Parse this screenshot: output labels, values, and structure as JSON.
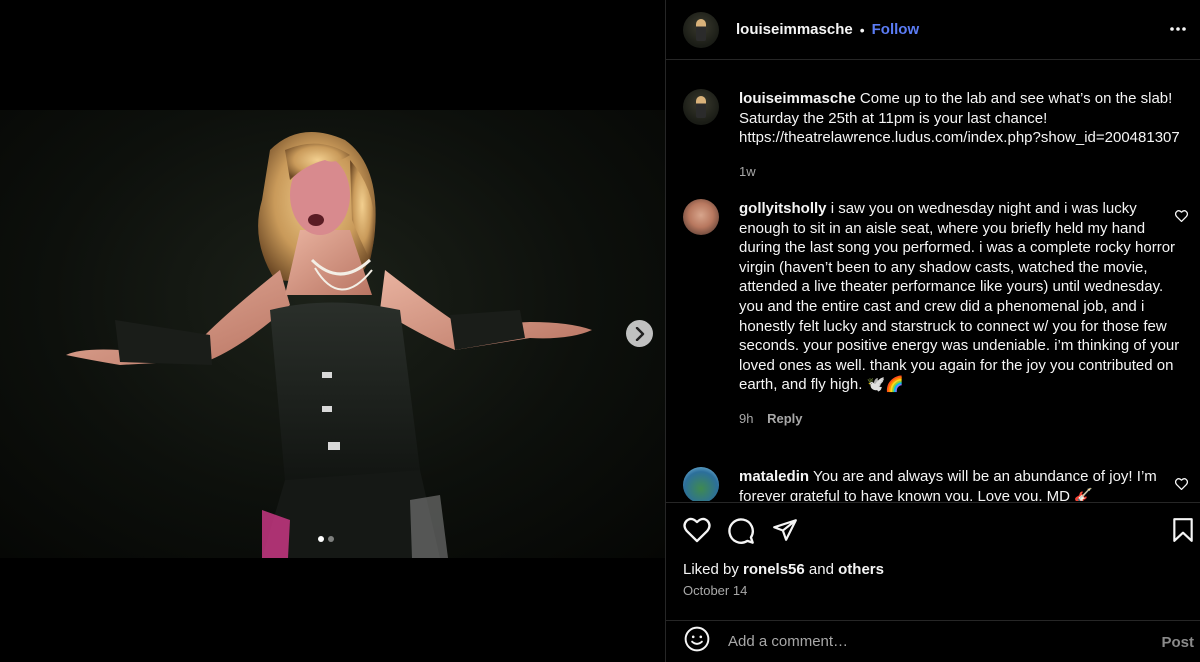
{
  "post": {
    "author": "louiseimmasche",
    "separator": "•",
    "follow_label": "Follow",
    "more_icon": "more-horizontal-icon",
    "carousel": {
      "slide_count": 2,
      "active_slide": 1
    }
  },
  "caption": {
    "username": "louiseimmasche",
    "text": "Come up to the lab and see what’s on the slab! Saturday the 25th at 11pm is your last chance! https://theatrelawrence.ludus.com/index.php?show_id=200481307",
    "time": "1w"
  },
  "comments": [
    {
      "username": "gollyitsholly",
      "text": "i saw you on wednesday night and i was lucky enough to sit in an aisle seat, where you briefly held my hand during the last song you performed. i was a complete rocky horror virgin (haven’t been to any shadow casts, watched the movie, attended a live theater performance like yours) until wednesday. you and the entire cast and crew did a phenomenal job, and i honestly felt lucky and starstruck to connect w/ you for those few seconds. your positive energy was undeniable. i’m thinking of your loved ones as well. thank you again for the joy you contributed on earth, and fly high. 🕊️🌈",
      "time": "9h",
      "reply_label": "Reply"
    },
    {
      "username": "mataledin",
      "text": "You are and always will be an abundance of joy! I’m forever grateful to have known you. Love you, MD 🎸"
    }
  ],
  "likes": {
    "prefix": "Liked by",
    "user": "ronels56",
    "and": "and",
    "others": "others"
  },
  "date": "October 14",
  "add_comment": {
    "placeholder": "Add a comment…",
    "post_label": "Post"
  }
}
